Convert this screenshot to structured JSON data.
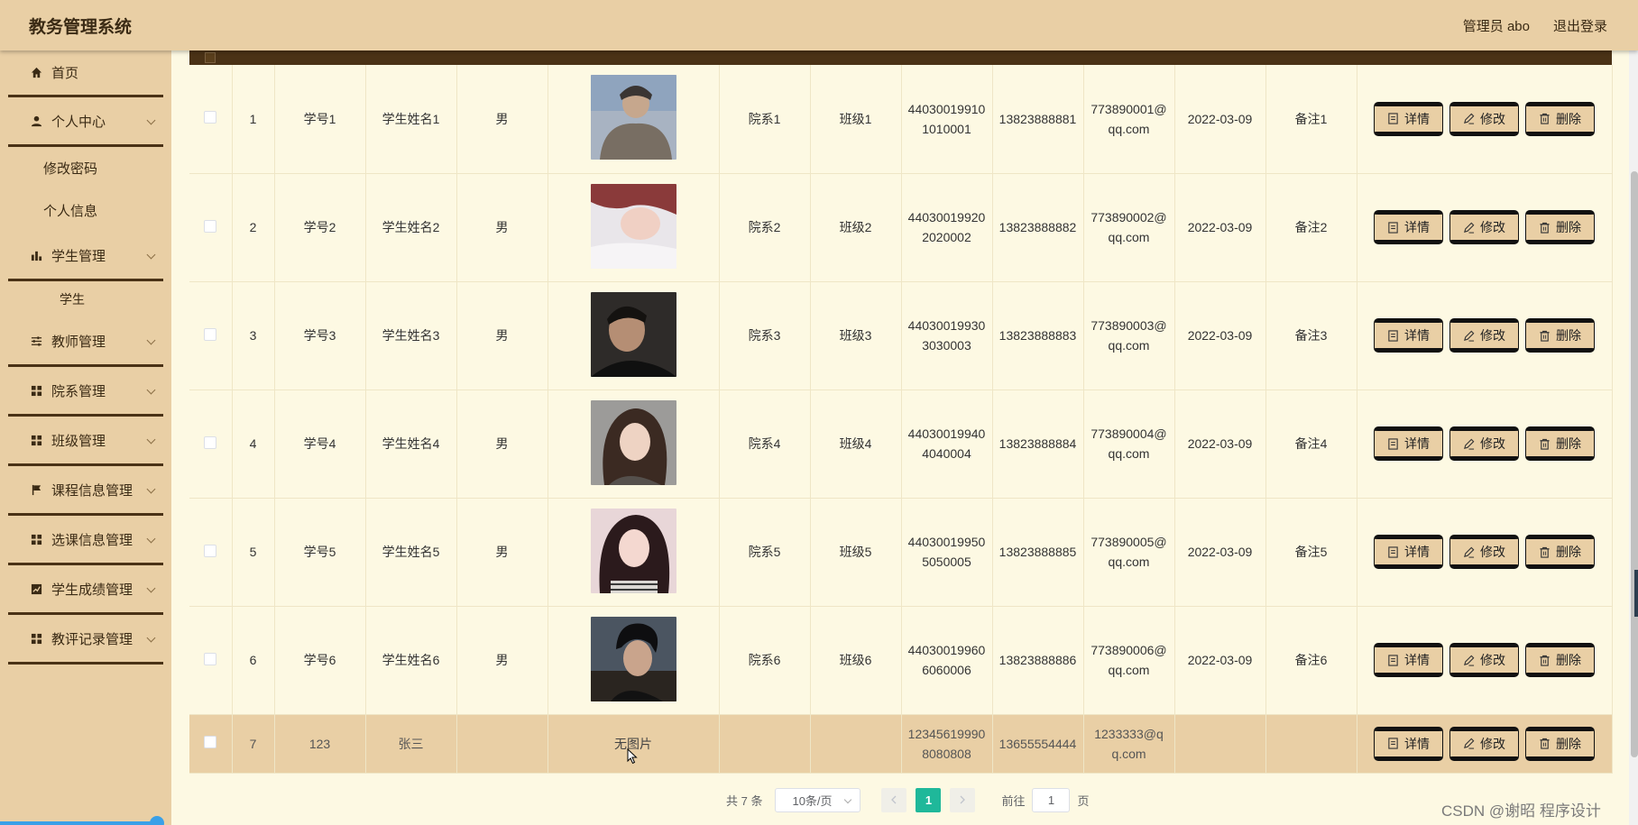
{
  "header": {
    "app_title": "教务管理系统",
    "user_label": "管理员 abo",
    "logout_label": "退出登录"
  },
  "sidebar": {
    "home": "首页",
    "personal_center": "个人中心",
    "change_password": "修改密码",
    "personal_info": "个人信息",
    "student_mgmt": "学生管理",
    "student_leaf": "学生",
    "teacher_mgmt": "教师管理",
    "department_mgmt": "院系管理",
    "class_mgmt": "班级管理",
    "course_mgmt": "课程信息管理",
    "course_select_mgmt": "选课信息管理",
    "grade_mgmt": "学生成绩管理",
    "evaluation_mgmt": "教评记录管理"
  },
  "buttons": {
    "detail": "详情",
    "edit": "修改",
    "delete": "删除"
  },
  "rows": [
    {
      "index": "1",
      "student_no": "学号1",
      "name": "学生姓名1",
      "gender": "男",
      "dept": "院系1",
      "cls": "班级1",
      "id_card": "440300199101010001",
      "phone": "13823888881",
      "email": "773890001@qq.com",
      "date": "2022-03-09",
      "remark": "备注1"
    },
    {
      "index": "2",
      "student_no": "学号2",
      "name": "学生姓名2",
      "gender": "男",
      "dept": "院系2",
      "cls": "班级2",
      "id_card": "440300199202020002",
      "phone": "13823888882",
      "email": "773890002@qq.com",
      "date": "2022-03-09",
      "remark": "备注2"
    },
    {
      "index": "3",
      "student_no": "学号3",
      "name": "学生姓名3",
      "gender": "男",
      "dept": "院系3",
      "cls": "班级3",
      "id_card": "440300199303030003",
      "phone": "13823888883",
      "email": "773890003@qq.com",
      "date": "2022-03-09",
      "remark": "备注3"
    },
    {
      "index": "4",
      "student_no": "学号4",
      "name": "学生姓名4",
      "gender": "男",
      "dept": "院系4",
      "cls": "班级4",
      "id_card": "440300199404040004",
      "phone": "13823888884",
      "email": "773890004@qq.com",
      "date": "2022-03-09",
      "remark": "备注4"
    },
    {
      "index": "5",
      "student_no": "学号5",
      "name": "学生姓名5",
      "gender": "男",
      "dept": "院系5",
      "cls": "班级5",
      "id_card": "440300199505050005",
      "phone": "13823888885",
      "email": "773890005@qq.com",
      "date": "2022-03-09",
      "remark": "备注5"
    },
    {
      "index": "6",
      "student_no": "学号6",
      "name": "学生姓名6",
      "gender": "男",
      "dept": "院系6",
      "cls": "班级6",
      "id_card": "440300199606060006",
      "phone": "13823888886",
      "email": "773890006@qq.com",
      "date": "2022-03-09",
      "remark": "备注6"
    },
    {
      "index": "7",
      "student_no": "123",
      "name": "张三",
      "gender": "",
      "dept": "",
      "cls": "",
      "id_card": "123456199908080808",
      "phone": "13655554444",
      "email": "1233333@qq.com",
      "date": "",
      "remark": "",
      "photo_text": "无图片"
    }
  ],
  "pagination": {
    "total": "共 7 条",
    "page_size": "10条/页",
    "current_page": "1",
    "goto_label": "前往",
    "goto_value": "1",
    "page_unit": "页"
  },
  "watermark": "CSDN @谢昭  程序设计",
  "colors": {
    "topbar": "#e9cfa5",
    "sidebar": "#e9cfa5",
    "table_header": "#4a3216",
    "row_bg": "#fdf9e3",
    "active_page": "#1fb89a"
  }
}
